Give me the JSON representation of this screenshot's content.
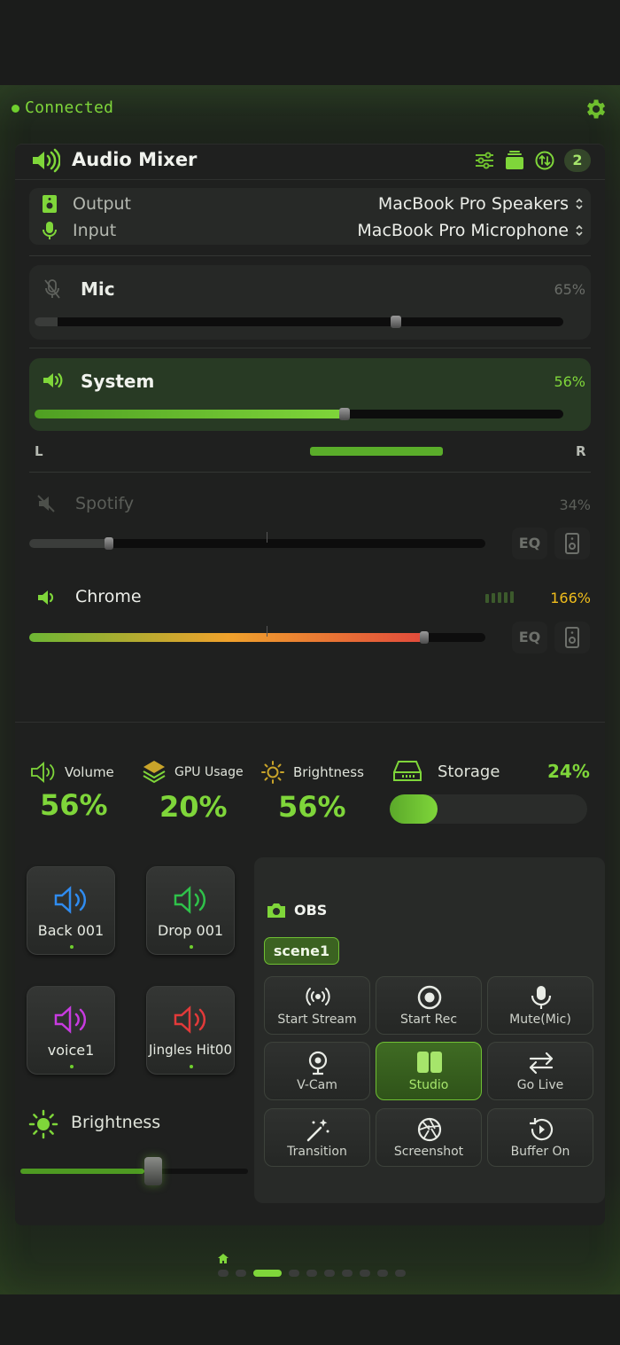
{
  "status": {
    "text": "Connected",
    "color": "#6fcf2e"
  },
  "header": {
    "title": "Audio Mixer",
    "icons": [
      "speaker-icon",
      "sliders-icon",
      "layers-icon",
      "swap-icon"
    ],
    "badge_count": "2"
  },
  "devices": {
    "output_label": "Output",
    "output_value": "MacBook Pro Speakers",
    "input_label": "Input",
    "input_value": "MacBook Pro Microphone"
  },
  "channels": {
    "mic": {
      "name": "Mic",
      "percent": "65%",
      "level": 0.65,
      "muted": true
    },
    "system": {
      "name": "System",
      "percent": "56%",
      "level": 0.56
    },
    "balance": {
      "left": "L",
      "right": "R"
    },
    "spotify": {
      "name": "Spotify",
      "percent": "34%",
      "level": 0.34,
      "muted": true,
      "eq": "EQ"
    },
    "chrome": {
      "name": "Chrome",
      "percent": "166%",
      "level": 0.9,
      "eq": "EQ"
    }
  },
  "stats": {
    "volume": {
      "label": "Volume",
      "value": "56%"
    },
    "gpu": {
      "label": "GPU Usage",
      "value": "20%"
    },
    "brightness": {
      "label": "Brightness",
      "value": "56%"
    },
    "storage": {
      "label": "Storage",
      "value": "24%",
      "level": 0.24
    }
  },
  "pads": [
    {
      "label": "Back 001",
      "color": "#2f8cf0"
    },
    {
      "label": "Drop 001",
      "color": "#2fc24a"
    },
    {
      "label": "voice1",
      "color": "#c83be0"
    },
    {
      "label": "Jingles Hit00",
      "color": "#e23a3a"
    }
  ],
  "brightness_slider": {
    "label": "Brightness",
    "level": 0.56
  },
  "obs": {
    "title": "OBS",
    "scene": "scene1",
    "buttons": [
      {
        "label": "Start Stream",
        "icon": "broadcast-icon"
      },
      {
        "label": "Start Rec",
        "icon": "record-icon"
      },
      {
        "label": "Mute(Mic)",
        "icon": "microphone-icon"
      },
      {
        "label": "V-Cam",
        "icon": "webcam-icon"
      },
      {
        "label": "Studio",
        "icon": "studio-icon",
        "active": true
      },
      {
        "label": "Go Live",
        "icon": "arrows-swap-icon"
      },
      {
        "label": "Transition",
        "icon": "magic-wand-icon"
      },
      {
        "label": "Screenshot",
        "icon": "aperture-icon"
      },
      {
        "label": "Buffer On",
        "icon": "replay-icon"
      }
    ]
  },
  "pagination": {
    "pages": 10,
    "active": 2
  }
}
